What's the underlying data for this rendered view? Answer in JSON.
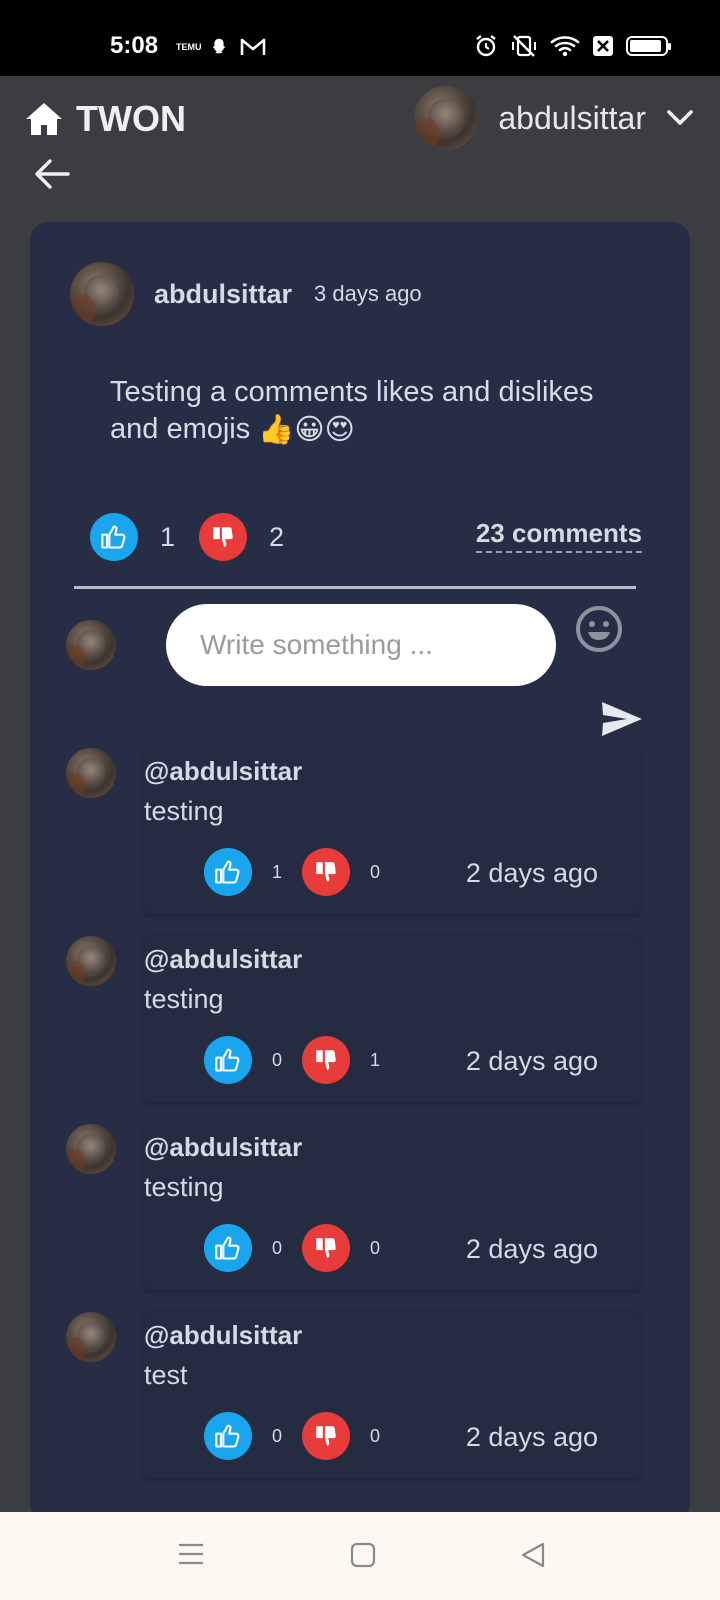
{
  "status_bar": {
    "time": "5:08",
    "left_icons": [
      "temu-icon",
      "snapchat-icon",
      "gmail-icon"
    ],
    "right_icons": [
      "alarm-icon",
      "vibrate-off-icon",
      "wifi-icon",
      "x-icon",
      "battery-icon"
    ],
    "temu_label": "TEMU",
    "battery_level": 0.9
  },
  "header": {
    "title": "TWON",
    "username": "abdulsittar"
  },
  "post": {
    "author": "abdulsittar",
    "time": "3 days ago",
    "text": "Testing a comments likes and dislikes and emojis ",
    "emojis": [
      "👍",
      "😀",
      "😍"
    ],
    "likes": "1",
    "dislikes": "2",
    "comments_link": "23 comments"
  },
  "composer": {
    "placeholder": "Write something ..."
  },
  "comments": [
    {
      "user": "@abdulsittar",
      "text": "testing",
      "likes": "1",
      "dislikes": "0",
      "time": "2 days ago"
    },
    {
      "user": "@abdulsittar",
      "text": "testing",
      "likes": "0",
      "dislikes": "1",
      "time": "2 days ago"
    },
    {
      "user": "@abdulsittar",
      "text": "testing",
      "likes": "0",
      "dislikes": "0",
      "time": "2 days ago"
    },
    {
      "user": "@abdulsittar",
      "text": "test",
      "likes": "0",
      "dislikes": "0",
      "time": "2 days ago"
    }
  ],
  "colors": {
    "card_bg": "#262d45",
    "like": "#1aa6ee",
    "dislike": "#e83c3a",
    "page_bg": "#3c3d40"
  }
}
